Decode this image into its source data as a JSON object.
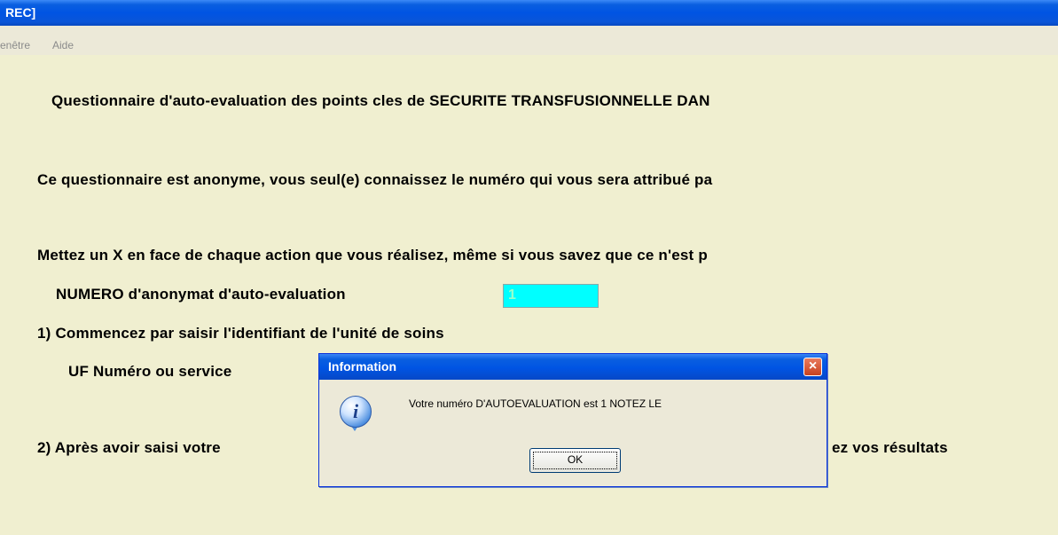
{
  "window": {
    "title": "REC]"
  },
  "menu": {
    "items": [
      "enêtre",
      "Aide"
    ]
  },
  "form": {
    "heading": "Questionnaire d'auto-evaluation des points cles de SECURITE TRANSFUSIONNELLE DAN",
    "anon_text": "Ce questionnaire est anonyme, vous seul(e) connaissez le numéro qui vous sera attribué pa",
    "instructions": "Mettez un  X en face de chaque action que vous réalisez, même si vous savez que ce n'est p",
    "numero_label": "NUMERO d'anonymat d'auto-evaluation",
    "numero_value": "1",
    "step1": "1) Commencez par saisir l'identifiant de l'unité de soins",
    "uf_label": "UF Numéro ou service",
    "step2_start": "2) Après avoir saisi votre",
    "step2_end": "ez vos résultats"
  },
  "dialog": {
    "title": "Information",
    "close_glyph": "×",
    "icon": "information-icon",
    "icon_glyph": "i",
    "message": "Votre numéro D'AUTOEVALUATION est  1   NOTEZ LE",
    "ok_label": "OK"
  },
  "colors": {
    "titlebar": "#0054e3",
    "background": "#f0efd0",
    "numero_field": "#00ffff",
    "close_button": "#c8421e"
  }
}
